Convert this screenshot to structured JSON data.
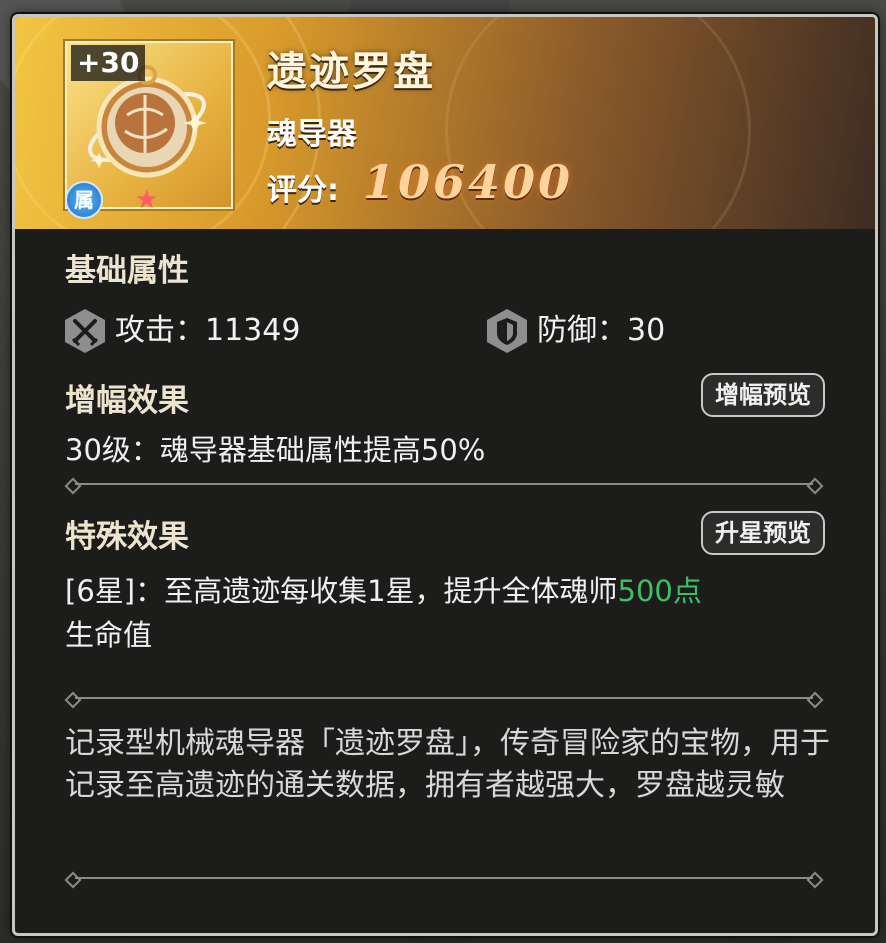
{
  "item": {
    "level": "+30",
    "name": "遗迹罗盘",
    "type": "魂导器",
    "score_label": "评分:",
    "score_value": "106400",
    "attr_badge": "属",
    "star_count": 1
  },
  "base_attributes": {
    "title": "基础属性",
    "attack_label": "攻击：11349",
    "defense_label": "防御：30"
  },
  "amplify": {
    "title": "增幅效果",
    "preview_button": "增幅预览",
    "effect": "30级：魂导器基础属性提高50%"
  },
  "special": {
    "title": "特殊效果",
    "preview_button": "升星预览",
    "effect_prefix": "[6星]：至高遗迹每收集1星，提升全体魂师",
    "effect_highlight": "500点",
    "effect_suffix": "生命值"
  },
  "description": "记录型机械魂导器「遗迹罗盘」，传奇冒险家的宝物，用于记录至高遗迹的通关数据，拥有者越强大，罗盘越灵敏",
  "colors": {
    "highlight_green": "#3fbf63",
    "score_orange": "#ffd39c",
    "header_gold": "#f3c542"
  }
}
